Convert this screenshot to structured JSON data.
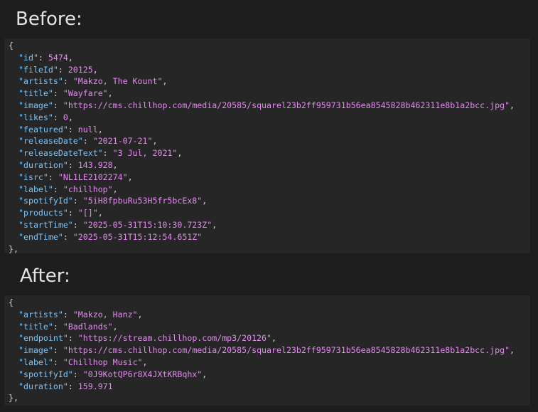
{
  "before": {
    "heading": "Before:",
    "open": "{",
    "close": "},",
    "fields": [
      {
        "key": "\"id\"",
        "value": "5474",
        "type": "num",
        "comma": ","
      },
      {
        "key": "\"fileId\"",
        "value": "20125",
        "type": "num",
        "comma": ","
      },
      {
        "key": "\"artists\"",
        "value": "\"Makzo, The Kount\"",
        "type": "str",
        "comma": ","
      },
      {
        "key": "\"title\"",
        "value": "\"Wayfare\"",
        "type": "str",
        "comma": ","
      },
      {
        "key": "\"image\"",
        "value": "\"https://cms.chillhop.com/media/20585/squarel23b2ff959731b56ea8545828b462311e8b1a2bcc.jpg\"",
        "type": "str",
        "comma": ","
      },
      {
        "key": "\"likes\"",
        "value": "0",
        "type": "num",
        "comma": ","
      },
      {
        "key": "\"featured\"",
        "value": "null",
        "type": "null",
        "comma": ","
      },
      {
        "key": "\"releaseDate\"",
        "value": "\"2021-07-21\"",
        "type": "str",
        "comma": ","
      },
      {
        "key": "\"releaseDateText\"",
        "value": "\"3 Jul, 2021\"",
        "type": "str",
        "comma": ","
      },
      {
        "key": "\"duration\"",
        "value": "143.928",
        "type": "num",
        "comma": ","
      },
      {
        "key": "\"isrc\"",
        "value": "\"NL1LE2102274\"",
        "type": "str",
        "comma": ","
      },
      {
        "key": "\"label\"",
        "value": "\"chillhop\"",
        "type": "str",
        "comma": ","
      },
      {
        "key": "\"spotifyId\"",
        "value": "\"5iH8fpbuRu53H5fr5bcEx8\"",
        "type": "str",
        "comma": ","
      },
      {
        "key": "\"products\"",
        "value": "\"[]\"",
        "type": "str",
        "comma": ","
      },
      {
        "key": "\"startTime\"",
        "value": "\"2025-05-31T15:10:30.723Z\"",
        "type": "str",
        "comma": ","
      },
      {
        "key": "\"endTime\"",
        "value": "\"2025-05-31T15:12:54.651Z\"",
        "type": "str",
        "comma": ""
      }
    ]
  },
  "after": {
    "heading": "After:",
    "open": "{",
    "close": "},",
    "fields": [
      {
        "key": "\"artists\"",
        "value": "\"Makzo, Hanz\"",
        "type": "str",
        "comma": ","
      },
      {
        "key": "\"title\"",
        "value": "\"Badlands\"",
        "type": "str",
        "comma": ","
      },
      {
        "key": "\"endpoint\"",
        "value": "\"https://stream.chillhop.com/mp3/20126\"",
        "type": "str",
        "comma": ","
      },
      {
        "key": "\"image\"",
        "value": "\"https://cms.chillhop.com/media/20585/squarel23b2ff959731b56ea8545828b462311e8b1a2bcc.jpg\"",
        "type": "str",
        "comma": ","
      },
      {
        "key": "\"label\"",
        "value": "\"Chillhop Music\"",
        "type": "str",
        "comma": ","
      },
      {
        "key": "\"spotifyId\"",
        "value": "\"0J9KotQP6r8X4JXtKRBqhx\"",
        "type": "str",
        "comma": ","
      },
      {
        "key": "\"duration\"",
        "value": "159.971",
        "type": "num",
        "comma": ""
      }
    ]
  },
  "separator": ": "
}
